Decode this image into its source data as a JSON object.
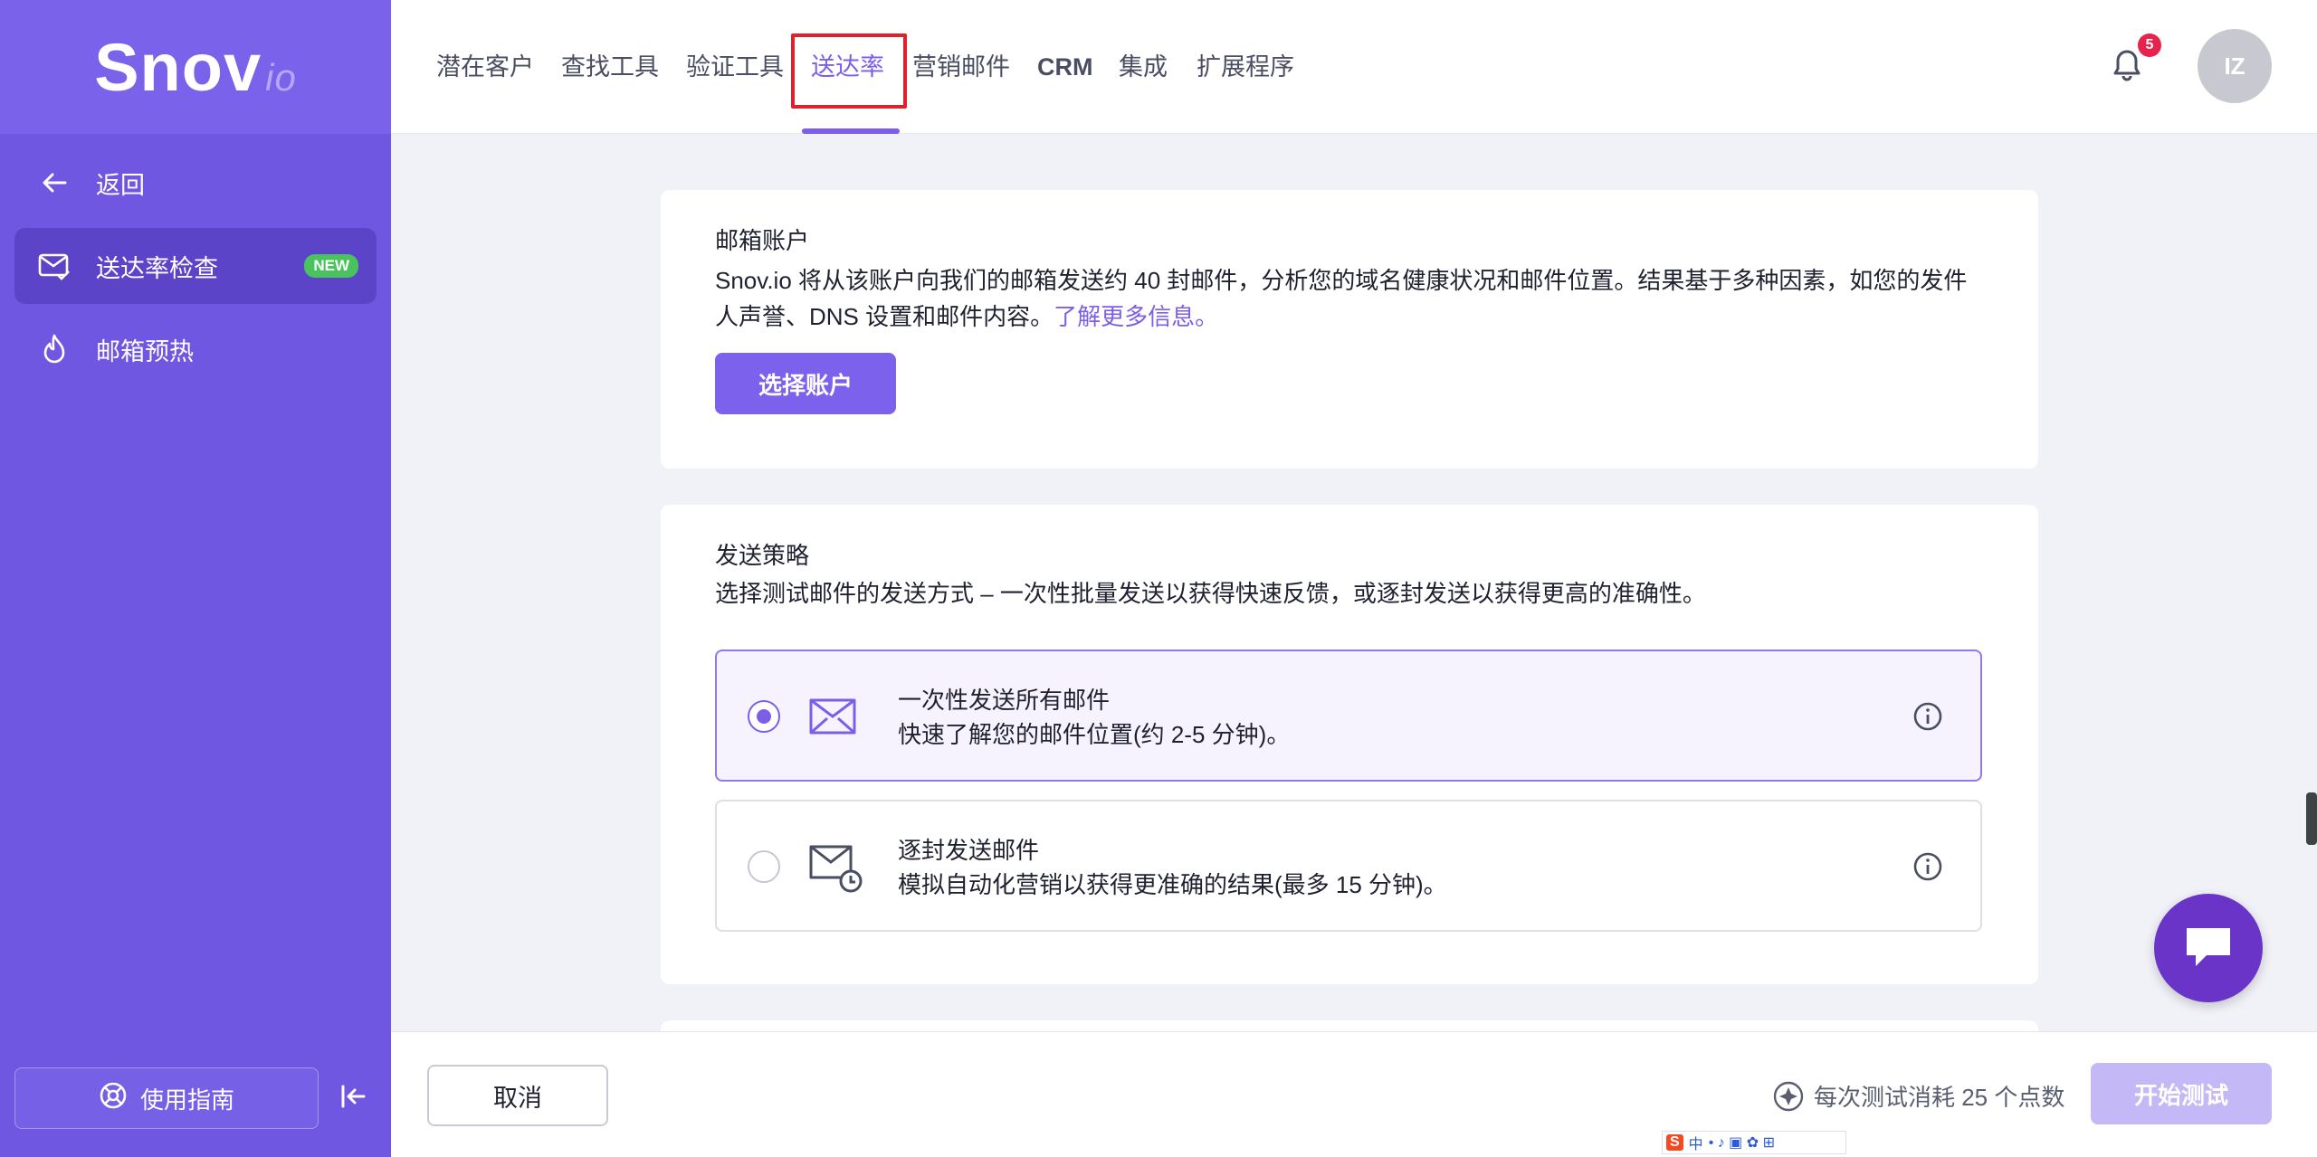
{
  "brand": {
    "name": "Snov",
    "suffix": "io"
  },
  "sidebar": {
    "back_label": "返回",
    "items": [
      {
        "label": "送达率检查",
        "badge": "NEW",
        "icon": "mail-check-icon",
        "active": true
      },
      {
        "label": "邮箱预热",
        "icon": "flame-icon",
        "active": false
      }
    ],
    "guide_label": "使用指南"
  },
  "nav": {
    "items": [
      "潜在客户",
      "查找工具",
      "验证工具",
      "送达率",
      "营销邮件",
      "CRM",
      "集成",
      "扩展程序"
    ],
    "active": "送达率",
    "notification_count": "5",
    "avatar_initials": "IZ"
  },
  "account_card": {
    "title": "邮箱账户",
    "description_line1": "Snov.io 将从该账户向我们的邮箱发送约 40 封邮件，分析您的域名健康状况和邮件位置。结果基于多种因素，如您的发件",
    "description_line2": "人声誉、DNS 设置和邮件内容。",
    "learn_more": "了解更多信息。",
    "select_button": "选择账户"
  },
  "strategy_card": {
    "title": "发送策略",
    "description": "选择测试邮件的发送方式 – 一次性批量发送以获得快速反馈，或逐封发送以获得更高的准确性。",
    "options": [
      {
        "title": "一次性发送所有邮件",
        "subtitle": "快速了解您的邮件位置(约 2-5 分钟)。",
        "selected": true
      },
      {
        "title": "逐封发送邮件",
        "subtitle": "模拟自动化营销以获得更准确的结果(最多 15 分钟)。",
        "selected": false
      }
    ]
  },
  "footer": {
    "cancel_label": "取消",
    "cost_text": "每次测试消耗 25 个点数",
    "start_label": "开始测试"
  },
  "ime": {
    "logo": "S",
    "label": "中"
  },
  "colors": {
    "accent": "#7c5ee9",
    "sidebar": "#6f57e1",
    "highlight": "#e0212b"
  }
}
